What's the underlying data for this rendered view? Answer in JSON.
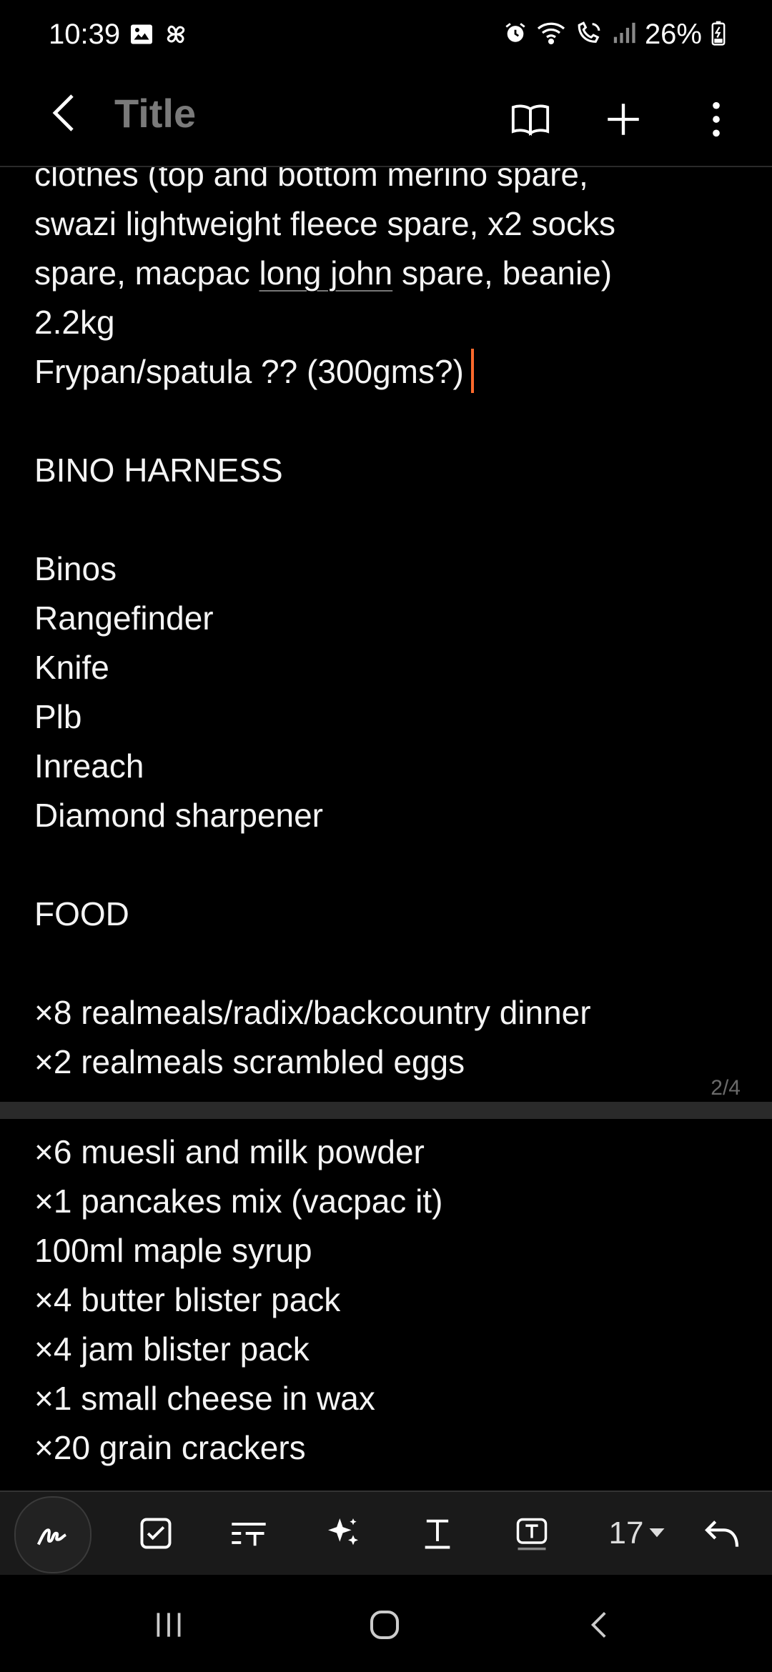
{
  "status": {
    "time": "10:39",
    "battery": "26%"
  },
  "app_bar": {
    "title": "Title"
  },
  "note": {
    "page1_lines": [
      "clothes (top and bottom merino spare,",
      "swazi lightweight fleece spare, x2 socks",
      "spare, macpac long john spare, beanie)",
      "2.2kg",
      "Frypan/spatula ?? (300gms?)",
      "",
      "BINO HARNESS",
      "",
      "Binos",
      "Rangefinder",
      "Knife",
      "Plb",
      "Inreach",
      "Diamond sharpener",
      "",
      "FOOD",
      "",
      "×8 realmeals/radix/backcountry dinner",
      "×2 realmeals scrambled eggs"
    ],
    "line2_a": "spare, macpac ",
    "line2_b": "long john",
    "line2_c": " spare, beanie)",
    "page_indicator": "2/4",
    "page2_lines": [
      "×6 muesli and milk powder",
      "×1 pancakes mix (vacpac it)",
      "100ml maple syrup",
      "×4 butter blister pack",
      "×4 jam blister pack",
      "×1 small cheese in wax",
      "×20 grain crackers"
    ]
  },
  "toolbar": {
    "font_size": "17"
  },
  "colors": {
    "background": "#000000",
    "cursor": "#ff6a2c",
    "title_gray": "#7a7a7a"
  }
}
